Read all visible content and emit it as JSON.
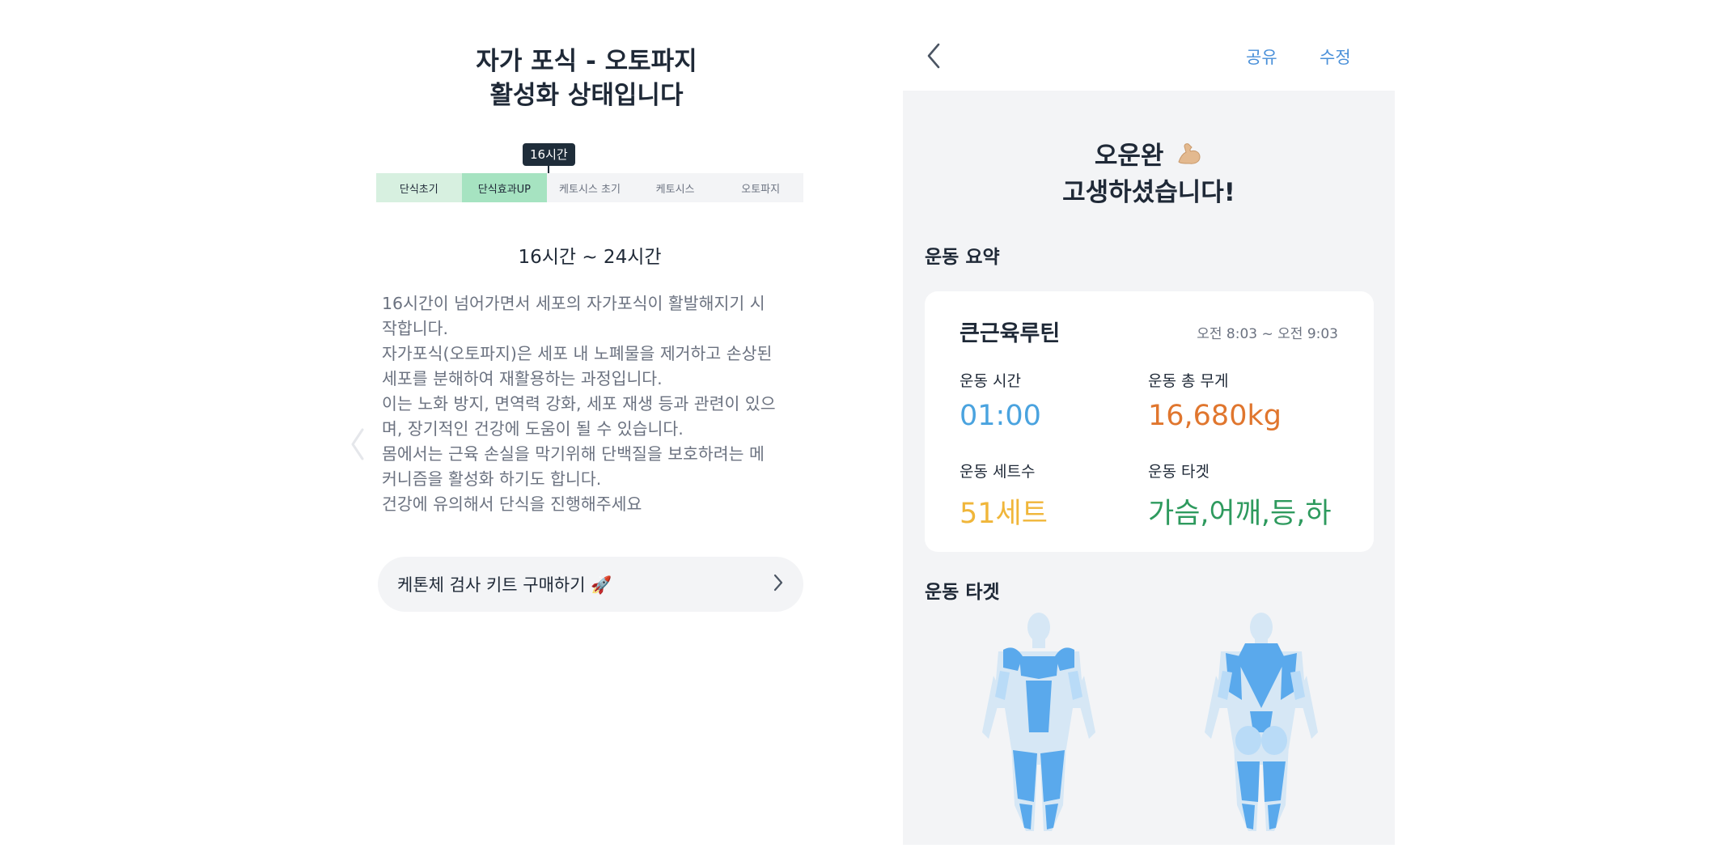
{
  "fasting": {
    "title_line1": "자가 포식 - 오토파지",
    "title_line2": "활성화 상태입니다",
    "marker": "16시간",
    "stages": [
      "단식초기",
      "단식효과UP",
      "케토시스 초기",
      "케토시스",
      "오토파지"
    ],
    "range": "16시간 ~ 24시간",
    "description": [
      "16시간이 넘어가면서 세포의 자가포식이 활발해지기 시",
      "작합니다.",
      "자가포식(오토파지)은 세포 내 노폐물을 제거하고 손상된",
      "세포를 분해하여 재활용하는 과정입니다.",
      "이는 노화 방지, 면역력 강화, 세포 재생 등과 관련이 있으",
      "며, 장기적인 건강에 도움이 될 수 있습니다.",
      "몸에서는 근육 손실을 막기위해 단백질을 보호하려는 메",
      "커니즘을 활성화 하기도 합니다.",
      "건강에 유의해서 단식을 진행해주세요"
    ],
    "kit_button": "케톤체 검사 키트 구매하기 🚀",
    "icons": {
      "prev": "chevron-left-icon",
      "kit_arrow": "chevron-right-icon"
    }
  },
  "workout": {
    "header": {
      "share": "공유",
      "edit": "수정"
    },
    "hero_line1": "오운완",
    "hero_line2": "고생하셨습니다!",
    "summary_title": "운동 요약",
    "routine_name": "큰근육루틴",
    "time_range": "오전 8:03 ~ 오전 9:03",
    "stats": [
      {
        "label": "운동 시간",
        "value": "01:00",
        "color": "#4aa3df"
      },
      {
        "label": "운동 총 무게",
        "value": "16,680kg",
        "color": "#e0762e"
      },
      {
        "label": "운동 세트수",
        "value": "51세트",
        "color": "#f0b63a"
      },
      {
        "label": "운동 타겟",
        "value": "가슴,어깨,등,하",
        "color": "#2e9a5e"
      }
    ],
    "target_title": "운동 타겟",
    "colors": {
      "muscle": "#5aa9ec",
      "muscle_light": "#b9dbf7",
      "skin": "#d6e7f5",
      "background": "#f3f4f6"
    }
  }
}
